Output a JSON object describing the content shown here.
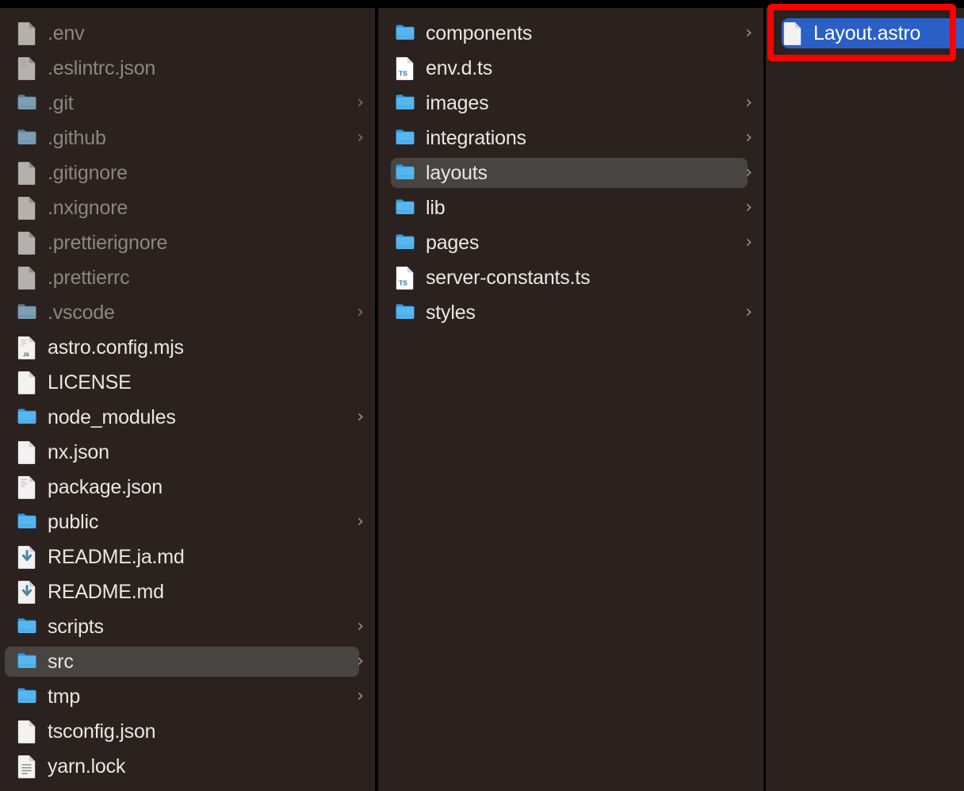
{
  "window": {
    "app": "Finder",
    "view": "column",
    "background_color": "#2b2220",
    "selection_color_inactive": "#474442",
    "selection_color_active": "#2b5fc8",
    "annotation_color": "#fe0000"
  },
  "columns": [
    {
      "name": "project-root-column",
      "items": [
        {
          "label": ".env",
          "icon": "file-plain-icon",
          "kind": "file",
          "hidden": true,
          "chevron": false,
          "selected": false
        },
        {
          "label": ".eslintrc.json",
          "icon": "file-text-icon",
          "kind": "file",
          "hidden": true,
          "chevron": false,
          "selected": false
        },
        {
          "label": ".git",
          "icon": "folder-icon",
          "kind": "folder",
          "hidden": true,
          "chevron": true,
          "selected": false
        },
        {
          "label": ".github",
          "icon": "folder-icon",
          "kind": "folder",
          "hidden": true,
          "chevron": true,
          "selected": false
        },
        {
          "label": ".gitignore",
          "icon": "file-plain-icon",
          "kind": "file",
          "hidden": true,
          "chevron": false,
          "selected": false
        },
        {
          "label": ".nxignore",
          "icon": "file-plain-icon",
          "kind": "file",
          "hidden": true,
          "chevron": false,
          "selected": false
        },
        {
          "label": ".prettierignore",
          "icon": "file-plain-icon",
          "kind": "file",
          "hidden": true,
          "chevron": false,
          "selected": false
        },
        {
          "label": ".prettierrc",
          "icon": "file-plain-icon",
          "kind": "file",
          "hidden": true,
          "chevron": false,
          "selected": false
        },
        {
          "label": ".vscode",
          "icon": "folder-icon",
          "kind": "folder",
          "hidden": true,
          "chevron": true,
          "selected": false
        },
        {
          "label": "astro.config.mjs",
          "icon": "file-js-icon",
          "kind": "file",
          "hidden": false,
          "chevron": false,
          "selected": false
        },
        {
          "label": "LICENSE",
          "icon": "file-plain-icon",
          "kind": "file",
          "hidden": false,
          "chevron": false,
          "selected": false
        },
        {
          "label": "node_modules",
          "icon": "folder-icon",
          "kind": "folder",
          "hidden": false,
          "chevron": true,
          "selected": false
        },
        {
          "label": "nx.json",
          "icon": "file-plain-icon",
          "kind": "file",
          "hidden": false,
          "chevron": false,
          "selected": false
        },
        {
          "label": "package.json",
          "icon": "file-text-icon",
          "kind": "file",
          "hidden": false,
          "chevron": false,
          "selected": false
        },
        {
          "label": "public",
          "icon": "folder-icon",
          "kind": "folder",
          "hidden": false,
          "chevron": true,
          "selected": false
        },
        {
          "label": "README.ja.md",
          "icon": "file-markdown-icon",
          "kind": "file",
          "hidden": false,
          "chevron": false,
          "selected": false
        },
        {
          "label": "README.md",
          "icon": "file-markdown-icon",
          "kind": "file",
          "hidden": false,
          "chevron": false,
          "selected": false
        },
        {
          "label": "scripts",
          "icon": "folder-icon",
          "kind": "folder",
          "hidden": false,
          "chevron": true,
          "selected": false
        },
        {
          "label": "src",
          "icon": "folder-icon",
          "kind": "folder",
          "hidden": false,
          "chevron": true,
          "selected": true
        },
        {
          "label": "tmp",
          "icon": "folder-icon",
          "kind": "folder",
          "hidden": false,
          "chevron": true,
          "selected": false
        },
        {
          "label": "tsconfig.json",
          "icon": "file-plain-icon",
          "kind": "file",
          "hidden": false,
          "chevron": false,
          "selected": false
        },
        {
          "label": "yarn.lock",
          "icon": "file-lines-icon",
          "kind": "file",
          "hidden": false,
          "chevron": false,
          "selected": false
        }
      ]
    },
    {
      "name": "src-column",
      "items": [
        {
          "label": "components",
          "icon": "folder-icon",
          "kind": "folder",
          "hidden": false,
          "chevron": true,
          "selected": false
        },
        {
          "label": "env.d.ts",
          "icon": "file-ts-icon",
          "kind": "file",
          "hidden": false,
          "chevron": false,
          "selected": false
        },
        {
          "label": "images",
          "icon": "folder-icon",
          "kind": "folder",
          "hidden": false,
          "chevron": true,
          "selected": false
        },
        {
          "label": "integrations",
          "icon": "folder-icon",
          "kind": "folder",
          "hidden": false,
          "chevron": true,
          "selected": false
        },
        {
          "label": "layouts",
          "icon": "folder-icon",
          "kind": "folder",
          "hidden": false,
          "chevron": true,
          "selected": true
        },
        {
          "label": "lib",
          "icon": "folder-icon",
          "kind": "folder",
          "hidden": false,
          "chevron": true,
          "selected": false
        },
        {
          "label": "pages",
          "icon": "folder-icon",
          "kind": "folder",
          "hidden": false,
          "chevron": true,
          "selected": false
        },
        {
          "label": "server-constants.ts",
          "icon": "file-ts-icon",
          "kind": "file",
          "hidden": false,
          "chevron": false,
          "selected": false
        },
        {
          "label": "styles",
          "icon": "folder-icon",
          "kind": "folder",
          "hidden": false,
          "chevron": true,
          "selected": false
        }
      ]
    },
    {
      "name": "layouts-column",
      "items": [
        {
          "label": "Layout.astro",
          "icon": "file-plain-icon",
          "kind": "file",
          "hidden": false,
          "chevron": false,
          "selected": true,
          "active": true
        }
      ]
    }
  ],
  "annotation": {
    "name": "highlight-box",
    "target_label": "Layout.astro",
    "color": "#fe0000"
  }
}
